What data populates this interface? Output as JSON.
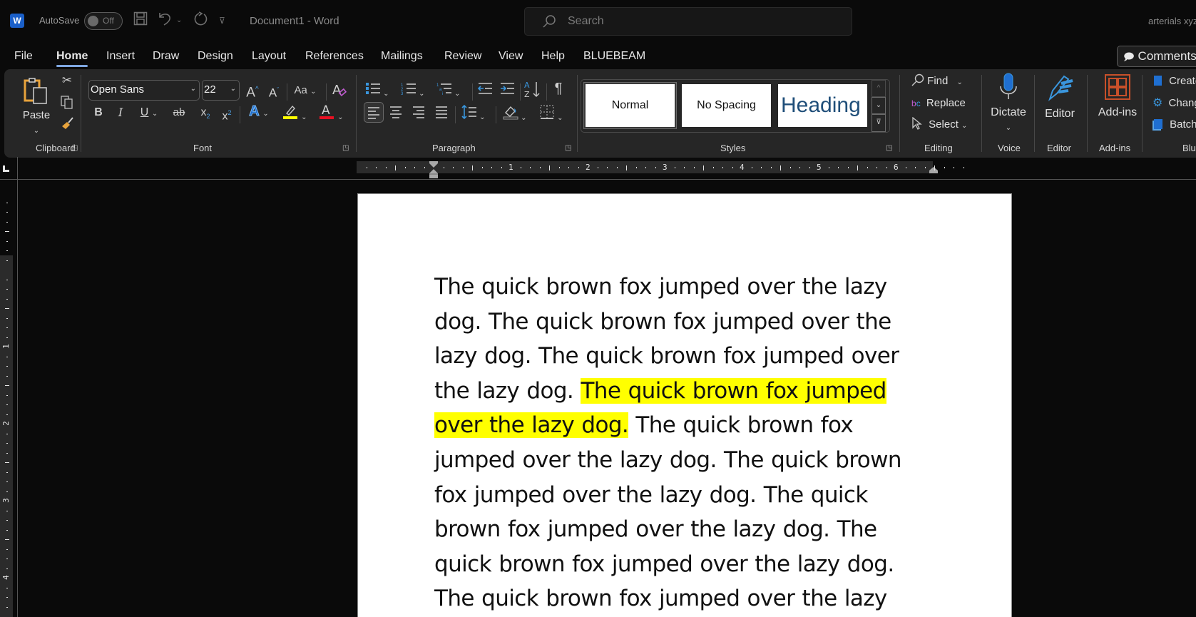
{
  "titlebar": {
    "app_icon": "word-logo-icon",
    "autosave_label": "AutoSave",
    "autosave_state": "Off",
    "document_title": "Document1  -  Word",
    "search_placeholder": "Search",
    "account_name": "arterials xyz"
  },
  "tabs": [
    {
      "label": "File"
    },
    {
      "label": "Home",
      "active": true
    },
    {
      "label": "Insert"
    },
    {
      "label": "Draw"
    },
    {
      "label": "Design"
    },
    {
      "label": "Layout"
    },
    {
      "label": "References"
    },
    {
      "label": "Mailings"
    },
    {
      "label": "Review"
    },
    {
      "label": "View"
    },
    {
      "label": "Help"
    },
    {
      "label": "BLUEBEAM"
    }
  ],
  "comments_button": "Comments",
  "ribbon": {
    "clipboard": {
      "label": "Clipboard",
      "paste": "Paste"
    },
    "font": {
      "label": "Font",
      "font_name": "Open Sans",
      "font_size": "22",
      "grow": "A",
      "shrink": "A",
      "change_case": "Aa",
      "bold": "B",
      "italic": "I",
      "underline": "U",
      "strike": "ab",
      "subscript": "x",
      "superscript": "x",
      "highlight_color": "#ffff00",
      "font_color": "#e81123"
    },
    "paragraph": {
      "label": "Paragraph"
    },
    "styles": {
      "label": "Styles",
      "items": [
        {
          "label": "Normal",
          "selected": true
        },
        {
          "label": "No Spacing"
        },
        {
          "label": "Heading 1"
        }
      ]
    },
    "editing": {
      "label": "Editing",
      "find": "Find",
      "replace": "Replace",
      "select": "Select"
    },
    "voice": {
      "label": "Voice",
      "dictate": "Dictate"
    },
    "editor": {
      "label": "Editor",
      "editor": "Editor"
    },
    "addins": {
      "label": "Add-ins",
      "addins": "Add-ins"
    },
    "bluebeam": {
      "label": "Bluebeam",
      "create": "Create PDF",
      "change": "Change Settings",
      "batch": "Batch PDF"
    }
  },
  "ruler": {
    "horizontal_numbers": [
      "1",
      "2",
      "3",
      "4",
      "5",
      "6"
    ],
    "vertical_numbers": [
      "1",
      "2",
      "3",
      "4"
    ]
  },
  "document": {
    "before_highlight": "The quick brown fox jumped over the lazy dog. The quick brown fox jumped over the lazy dog. The quick brown fox jumped over the lazy dog. ",
    "highlighted": "The quick brown fox jumped over the lazy dog.",
    "after_highlight": " The quick brown fox jumped over the lazy dog. The quick brown fox jumped over the lazy dog. The quick brown fox jumped over the lazy dog. The quick brown fox jumped over the lazy dog. The quick brown fox jumped over the lazy",
    "highlight_color": "#ffff00"
  }
}
